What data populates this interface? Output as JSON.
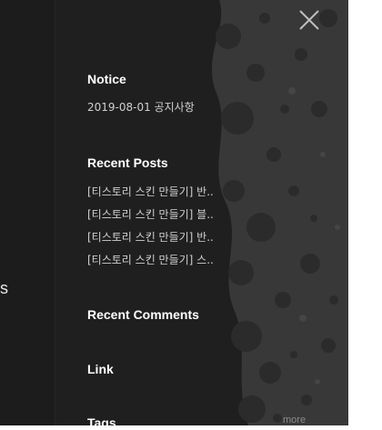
{
  "page": {
    "partial_text": "s"
  },
  "sidebar": {
    "close_icon": "close-icon",
    "notice": {
      "heading": "Notice",
      "items": [
        "2019-08-01 공지사항"
      ]
    },
    "recent_posts": {
      "heading": "Recent Posts",
      "items": [
        "[티스토리 스킨 만들기] 반..",
        "[티스토리 스킨 만들기] 블..",
        "[티스토리 스킨 만들기] 반..",
        "[티스토리 스킨 만들기] 스.."
      ]
    },
    "recent_comments": {
      "heading": "Recent Comments"
    },
    "link": {
      "heading": "Link"
    },
    "tags": {
      "heading": "Tags",
      "more_label": "more"
    }
  }
}
